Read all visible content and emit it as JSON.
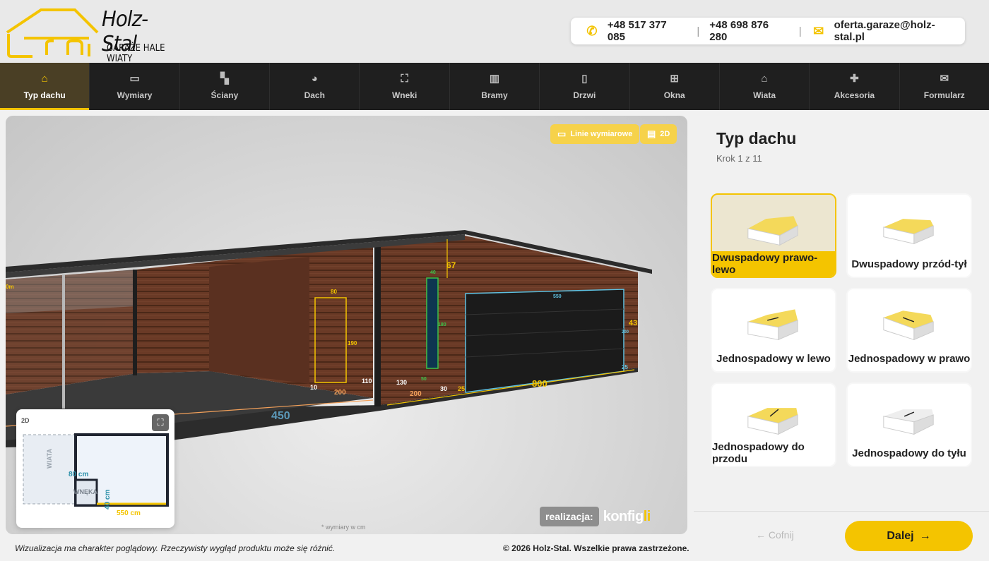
{
  "brand": {
    "name": "Holz-Stal",
    "tagline": "GARAŻE HALE WIATY"
  },
  "contact": {
    "phone1": "+48 517 377 085",
    "phone2": "+48 698 876 280",
    "email": "oferta.garaze@holz-stal.pl",
    "separator": "|"
  },
  "nav": {
    "items": [
      {
        "label": "Typ dachu",
        "icon": "home-icon",
        "glyph": "⌂"
      },
      {
        "label": "Wymiary",
        "icon": "ruler-icon",
        "glyph": "▭"
      },
      {
        "label": "Ściany",
        "icon": "paint-roller-icon",
        "glyph": "▚"
      },
      {
        "label": "Dach",
        "icon": "palette-icon",
        "glyph": "◕"
      },
      {
        "label": "Wneki",
        "icon": "expand-icon",
        "glyph": "⛶"
      },
      {
        "label": "Bramy",
        "icon": "gate-icon",
        "glyph": "▥"
      },
      {
        "label": "Drzwi",
        "icon": "door-icon",
        "glyph": "▯"
      },
      {
        "label": "Okna",
        "icon": "window-icon",
        "glyph": "⊞"
      },
      {
        "label": "Wiata",
        "icon": "carport-icon",
        "glyph": "⌂"
      },
      {
        "label": "Akcesoria",
        "icon": "puzzle-icon",
        "glyph": "✚"
      },
      {
        "label": "Formularz",
        "icon": "envelope-icon",
        "glyph": "✉"
      }
    ]
  },
  "viewer": {
    "btn_dimensions": "Linie wymiarowe",
    "btn_2d": "2D",
    "mini_map_label": "2D",
    "mini_wiata": "WIATA",
    "mini_wneka": "WNĘKA",
    "mini_width": "550 cm",
    "mini_depth_wneka": "80 cm",
    "mini_height_wneka": "40 cm",
    "realization_label": "realizacja:",
    "realization_brand_a": "konfig",
    "realization_brand_b": "li",
    "dims_note": "* wymiary w cm",
    "dims": {
      "length_main": "450",
      "width_garage": "800",
      "gate_width": "550",
      "door_width": "80",
      "door_height": "190",
      "window_width": "40",
      "window_height": "180",
      "roof_height": "67",
      "side_a": "43",
      "d200a": "200",
      "d200b": "200",
      "d10": "10",
      "d110": "110",
      "d130": "130",
      "d30": "30",
      "d25a": "25",
      "d25b": "25",
      "d50": "50",
      "d200side": "200",
      "d0m": "0m"
    }
  },
  "panel": {
    "title": "Typ dachu",
    "step": "Krok 1 z 11",
    "options": [
      {
        "label": "Dwuspadowy prawo-lewo",
        "selected": true
      },
      {
        "label": "Dwuspadowy przód-tył",
        "selected": false
      },
      {
        "label": "Jednospadowy w lewo",
        "selected": false
      },
      {
        "label": "Jednospadowy w prawo",
        "selected": false
      },
      {
        "label": "Jednospadowy do przodu",
        "selected": false
      },
      {
        "label": "Jednospadowy do tyłu",
        "selected": false
      }
    ],
    "back": "Cofnij",
    "next": "Dalej"
  },
  "footer": {
    "disclaimer": "Wizualizacja ma charakter poglądowy. Rzeczywisty wygląd produktu może się różnić.",
    "copyright": "© 2026 Holz-Stal. Wszelkie prawa zastrzeżone."
  },
  "colors": {
    "accent": "#f4c400",
    "nav_bg": "#1f1f1f",
    "nav_active": "#4a3f25"
  }
}
